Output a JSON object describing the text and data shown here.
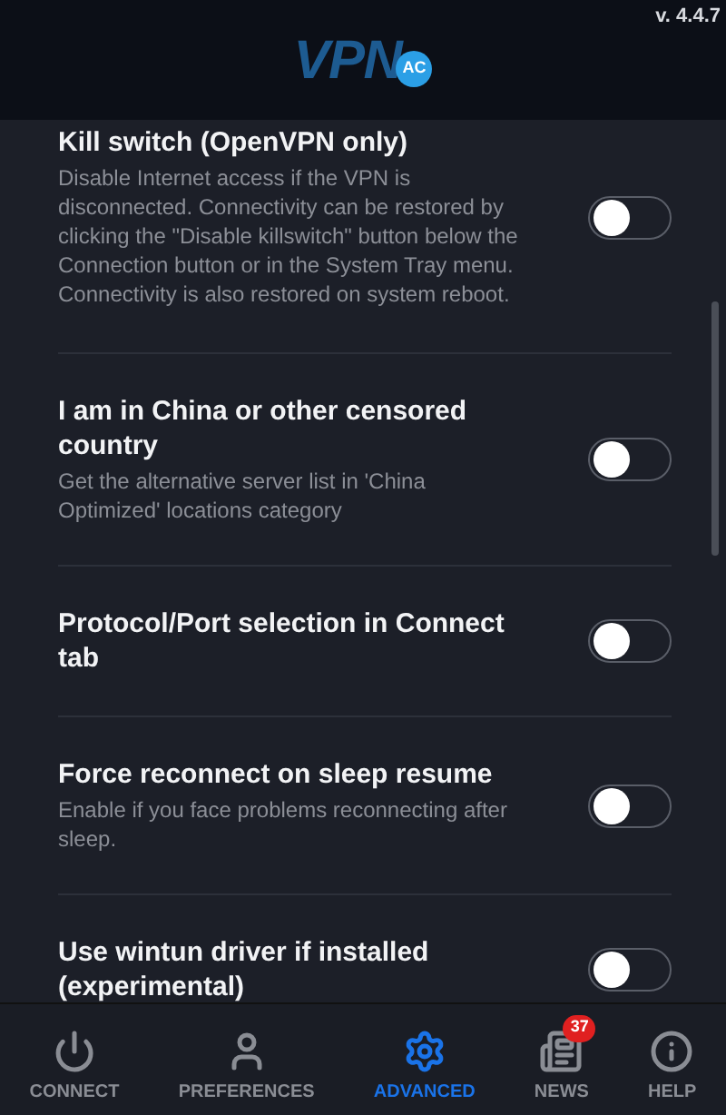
{
  "header": {
    "logo_text": "VPN",
    "logo_badge": "AC",
    "version": "v. 4.4.7"
  },
  "settings": [
    {
      "title": "Kill switch (OpenVPN only)",
      "description": "Disable Internet access if the VPN is disconnected. Connectivity can be restored by clicking the \"Disable killswitch\" button below the Connection button or in the System Tray menu. Connectivity is also restored on system reboot.",
      "on": false
    },
    {
      "title": "I am in China or other censored country",
      "description": "Get the alternative server list in 'China Optimized' locations category",
      "on": false
    },
    {
      "title": "Protocol/Port selection in Connect tab",
      "on": false
    },
    {
      "title": "Force reconnect on sleep resume",
      "description": "Enable if you face problems reconnecting after sleep.",
      "on": false
    },
    {
      "title": "Use wintun driver if installed (experimental)",
      "on": false
    }
  ],
  "nav": [
    {
      "kind": "power",
      "label": "CONNECT",
      "selected": false
    },
    {
      "kind": "person",
      "label": "PREFERENCES",
      "selected": false
    },
    {
      "kind": "gear",
      "label": "ADVANCED",
      "selected": true
    },
    {
      "kind": "news",
      "label": "NEWS",
      "selected": false,
      "badge": "37"
    },
    {
      "kind": "info",
      "label": "HELP",
      "selected": false
    }
  ]
}
